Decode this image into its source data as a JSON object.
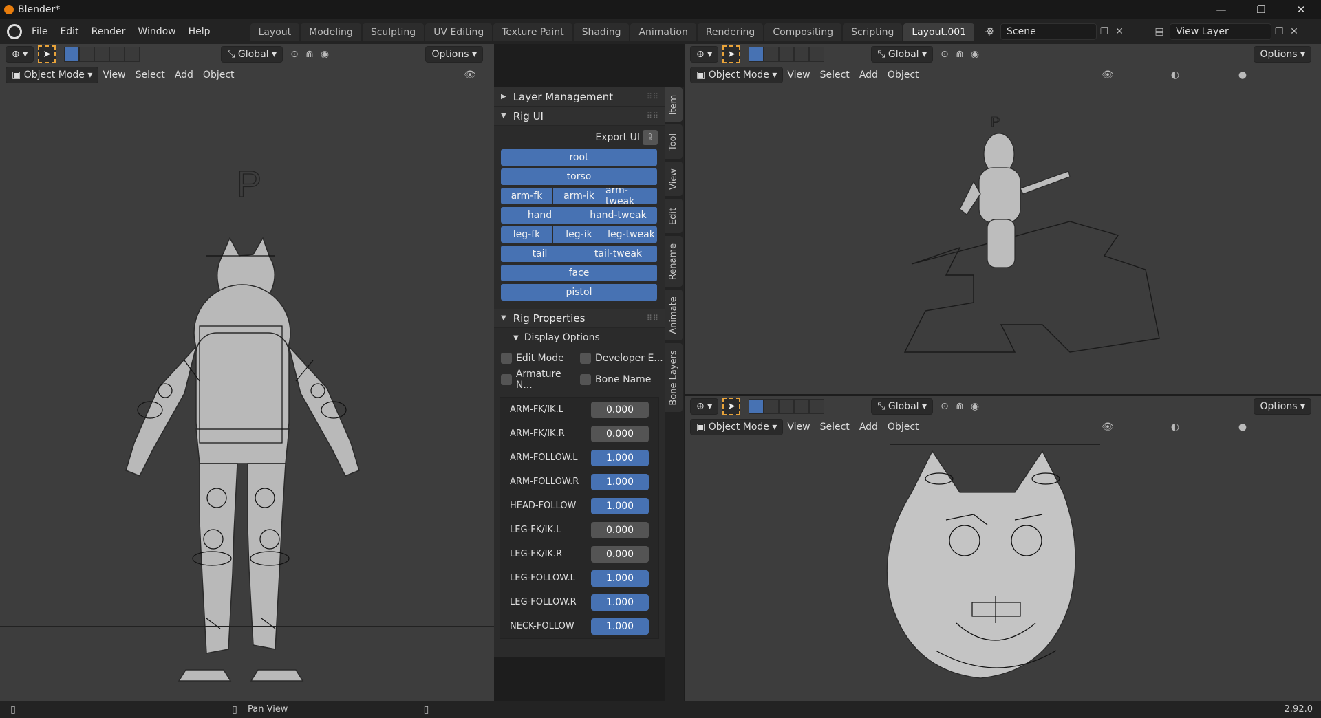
{
  "titlebar": {
    "title": "Blender*",
    "minimize": "—",
    "maximize": "❐",
    "close": "✕"
  },
  "menu": [
    "File",
    "Edit",
    "Render",
    "Window",
    "Help"
  ],
  "workspaces": {
    "tabs": [
      "Layout",
      "Modeling",
      "Sculpting",
      "UV Editing",
      "Texture Paint",
      "Shading",
      "Animation",
      "Rendering",
      "Compositing",
      "Scripting",
      "Layout.001"
    ],
    "active": "Layout.001",
    "add": "+"
  },
  "scene": {
    "name": "Scene",
    "view_layer": "View Layer"
  },
  "viewport_header": {
    "orientation": "Global",
    "options": "Options",
    "mode": "Object Mode",
    "menus": [
      "View",
      "Select",
      "Add",
      "Object"
    ]
  },
  "sidebar": {
    "tabs": [
      "Item",
      "Tool",
      "View",
      "Edit",
      "Rename",
      "Animate",
      "Bone Layers"
    ],
    "layer_management": "Layer Management",
    "rig_ui": {
      "title": "Rig UI",
      "export": "Export UI",
      "rows": [
        [
          "root"
        ],
        [
          "torso"
        ],
        [
          "arm-fk",
          "arm-ik",
          "arm-tweak"
        ],
        [
          "hand",
          "hand-tweak"
        ],
        [
          "leg-fk",
          "leg-ik",
          "leg-tweak"
        ],
        [
          "tail",
          "tail-tweak"
        ],
        [
          "face"
        ],
        [
          "pistol"
        ]
      ]
    },
    "rig_properties": {
      "title": "Rig Properties",
      "display_options": "Display Options",
      "checkboxes": [
        "Edit Mode",
        "Developer E...",
        "Armature N...",
        "Bone Name"
      ],
      "props": [
        {
          "label": "ARM-FK/IK.L",
          "value": "0.000",
          "active": false
        },
        {
          "label": "ARM-FK/IK.R",
          "value": "0.000",
          "active": false
        },
        {
          "label": "ARM-FOLLOW.L",
          "value": "1.000",
          "active": true
        },
        {
          "label": "ARM-FOLLOW.R",
          "value": "1.000",
          "active": true
        },
        {
          "label": "HEAD-FOLLOW",
          "value": "1.000",
          "active": true
        },
        {
          "label": "LEG-FK/IK.L",
          "value": "0.000",
          "active": false
        },
        {
          "label": "LEG-FK/IK.R",
          "value": "0.000",
          "active": false
        },
        {
          "label": "LEG-FOLLOW.L",
          "value": "1.000",
          "active": true
        },
        {
          "label": "LEG-FOLLOW.R",
          "value": "1.000",
          "active": true
        },
        {
          "label": "NECK-FOLLOW",
          "value": "1.000",
          "active": true
        }
      ]
    }
  },
  "viewport_text": {
    "p_marker": "P"
  },
  "statusbar": {
    "action": "Pan View",
    "version": "2.92.0"
  }
}
